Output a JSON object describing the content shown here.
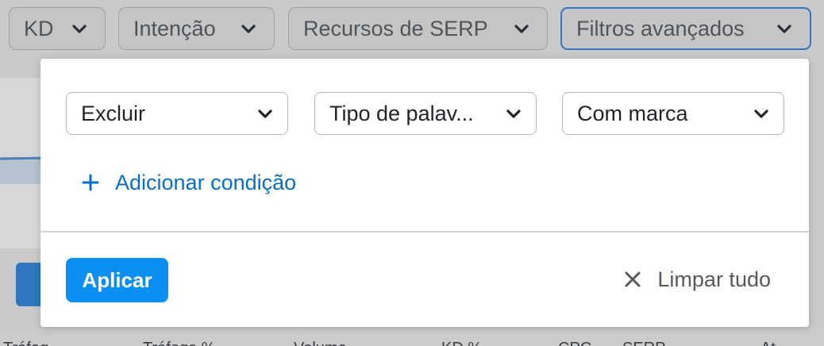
{
  "filters": {
    "kd": "KD",
    "intent": "Intenção",
    "serp_features": "Recursos de SERP",
    "advanced": "Filtros avançados"
  },
  "panel": {
    "condition": {
      "mode": "Excluir",
      "field": "Tipo de palav...",
      "value": "Com marca"
    },
    "add_condition": "Adicionar condição",
    "apply": "Aplicar",
    "clear_all": "Limpar tudo"
  },
  "background_table": {
    "columns": [
      "Tráfeg",
      "Tráfego %",
      "Volume",
      "KD %",
      "CPC",
      "SERP",
      "At"
    ]
  },
  "colors": {
    "accent": "#0b8ff2",
    "link": "#0a6fc2",
    "active_border": "#3575b9"
  }
}
